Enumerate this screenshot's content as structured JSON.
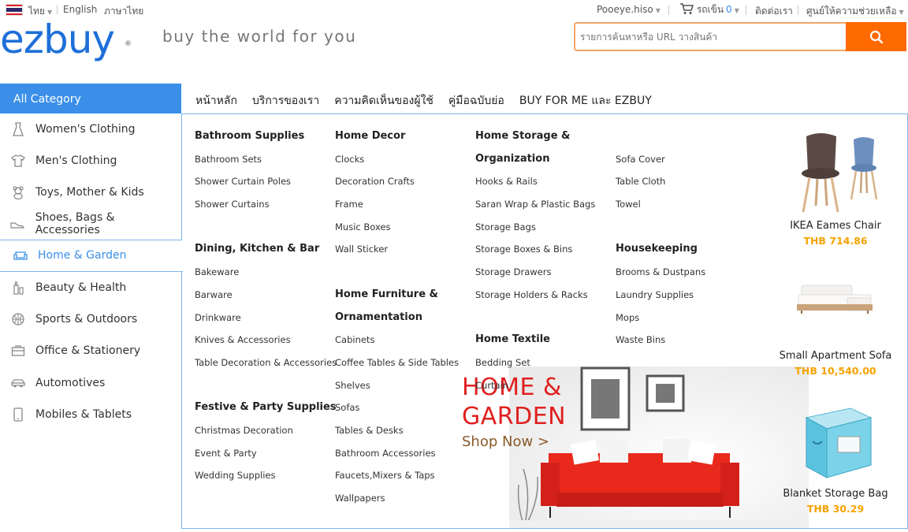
{
  "topbar": {
    "language_current": "ไทย",
    "language_options": [
      "English",
      "ภาษาไทย"
    ],
    "username": "Pooeye.hiso",
    "cart_label": "รถเข็น",
    "cart_count": "0",
    "contact_label": "ติดต่อเรา",
    "help_label": "ศูนย์ให้ความช่วยเหลือ"
  },
  "header": {
    "logo_text": "ezbuy",
    "logo_mark": "®",
    "tagline": "buy the world for you",
    "search_placeholder": "รายการค้นหาหรือ URL วางสินค้า"
  },
  "sidebar": {
    "all_category_label": "All Category",
    "items": [
      {
        "label": "Women's Clothing",
        "icon": "dress-icon"
      },
      {
        "label": "Men's Clothing",
        "icon": "shirt-icon"
      },
      {
        "label": "Toys, Mother & Kids",
        "icon": "teddy-bear-icon"
      },
      {
        "label": "Shoes, Bags & Accessories",
        "icon": "shoe-icon"
      },
      {
        "label": "Home & Garden",
        "icon": "sofa-icon",
        "active": true
      },
      {
        "label": "Beauty & Health",
        "icon": "bottle-icon"
      },
      {
        "label": "Sports & Outdoors",
        "icon": "ball-icon"
      },
      {
        "label": "Office & Stationery",
        "icon": "briefcase-icon"
      },
      {
        "label": "Automotives",
        "icon": "car-icon"
      },
      {
        "label": "Mobiles & Tablets",
        "icon": "phone-icon"
      }
    ]
  },
  "nav": {
    "items": [
      "หน้าหลัก",
      "บริการของเรา",
      "ความคิดเห็นของผู้ใช้",
      "คู่มือฉบับย่อ",
      "BUY FOR ME และ EZBUY"
    ]
  },
  "menu": {
    "col1": {
      "bathroom_supplies": {
        "title": "Bathroom Supplies",
        "items": [
          "Bathroom Sets",
          "Shower Curtain Poles",
          "Shower Curtains"
        ]
      },
      "dining": {
        "title": "Dining, Kitchen & Bar",
        "items": [
          "Bakeware",
          "Barware",
          "Drinkware",
          "Knives & Accessories",
          "Table Decoration & Accessories"
        ]
      },
      "festive": {
        "title": "Festive & Party Supplies",
        "items": [
          "Christmas Decoration",
          "Event & Party",
          "Wedding Supplies"
        ]
      }
    },
    "col2": {
      "home_decor": {
        "title": "Home Decor",
        "items": [
          "Clocks",
          "Decoration Crafts",
          "Frame",
          "Music Boxes",
          "Wall Sticker"
        ]
      },
      "home_furniture": {
        "title_line1": "Home Furniture &",
        "title_line2": "Ornamentation",
        "items": [
          "Cabinets",
          "Coffee Tables & Side Tables",
          "Shelves",
          "Sofas",
          "Tables & Desks",
          "Bathroom Accessories",
          "Faucets,Mixers & Taps",
          "Wallpapers"
        ]
      }
    },
    "col3": {
      "home_storage": {
        "title_line1": "Home Storage &",
        "title_line2": "Organization",
        "items": [
          "Hooks & Rails",
          "Saran Wrap & Plastic Bags",
          "Storage Bags",
          "Storage Boxes & Bins",
          "Storage Drawers",
          "Storage Holders & Racks"
        ]
      },
      "home_textile": {
        "title": "Home Textile",
        "items": [
          "Bedding Set",
          "Curtain"
        ]
      }
    },
    "col4": {
      "textile_cont": {
        "items": [
          "Sofa Cover",
          "Table Cloth",
          "Towel"
        ]
      },
      "housekeeping": {
        "title": "Housekeeping",
        "items": [
          "Brooms & Dustpans",
          "Laundry Supplies",
          "Mops",
          "Waste Bins"
        ]
      }
    }
  },
  "banner": {
    "title_line1": "HOME &",
    "title_line2": "GARDEN",
    "cta": "Shop Now >"
  },
  "products": [
    {
      "name": "IKEA Eames Chair",
      "price": "THB 714.86"
    },
    {
      "name": "Small Apartment Sofa",
      "price": "THB 10,540.00"
    },
    {
      "name": "Blanket Storage Bag",
      "price": "THB 30.29"
    }
  ],
  "colors": {
    "brand_blue": "#1e6fd9",
    "accent_blue": "#3b8fe8",
    "search_orange": "#ff6a00",
    "price_orange": "#f5a300",
    "banner_red": "#e02020"
  }
}
